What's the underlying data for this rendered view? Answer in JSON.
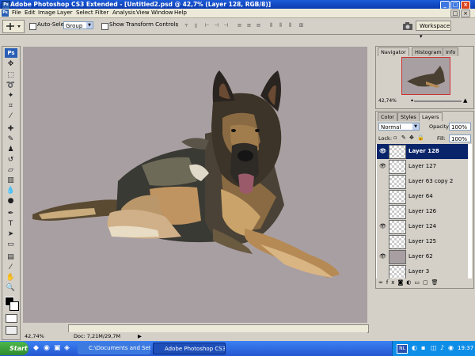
{
  "window": {
    "title": "Adobe Photoshop CS3 Extended - [Untitled2.psd @ 42,7% (Layer 128, RGB/8)]"
  },
  "menu": [
    "File",
    "Edit",
    "Image",
    "Layer",
    "Select",
    "Filter",
    "Analysis",
    "View",
    "Window",
    "Help"
  ],
  "options": {
    "auto_select_label": "Auto-Select:",
    "auto_select_value": "Group",
    "transform_label": "Show Transform Controls",
    "workspace_label": "Workspace ▾"
  },
  "tools_logo": "Ps",
  "status": {
    "zoom": "42,74%",
    "doc": "Doc: 7,21M/29,7M"
  },
  "navigator": {
    "tabs": [
      "Navigator",
      "Histogram",
      "Info"
    ],
    "zoom": "42,74%"
  },
  "layers_panel": {
    "tabs": [
      "Color",
      "Styles",
      "Layers"
    ],
    "blend_mode": "Normal",
    "opacity_label": "Opacity:",
    "opacity": "100%",
    "lock_label": "Lock:",
    "fill_label": "Fill:",
    "fill": "100%",
    "layers": [
      {
        "name": "Layer 128",
        "visible": true,
        "selected": true
      },
      {
        "name": "Layer 127",
        "visible": true
      },
      {
        "name": "Layer 63 copy 2",
        "visible": false
      },
      {
        "name": "Layer 64",
        "visible": false
      },
      {
        "name": "Layer 126",
        "visible": false
      },
      {
        "name": "Layer 124",
        "visible": true
      },
      {
        "name": "Layer 125",
        "visible": false
      },
      {
        "name": "Layer 62",
        "visible": true
      },
      {
        "name": "Layer 3",
        "visible": false
      }
    ]
  },
  "taskbar": {
    "start": "Start",
    "tasks": [
      "C:\\Documents and Settin...",
      "Adobe Photoshop CS3..."
    ],
    "lang": "NL",
    "clock": "19:37"
  },
  "colors": {
    "canvas": "#a89fa2",
    "selected_layer": "#0a246a",
    "taskbar": "#2457d0"
  }
}
